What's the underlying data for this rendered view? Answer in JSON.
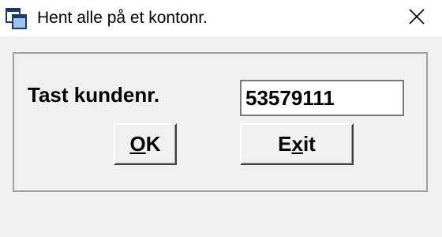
{
  "window": {
    "title": "Hent alle på et kontonr.",
    "icon": "app-window-icon",
    "close_icon": "close-icon"
  },
  "form": {
    "prompt_label": "Tast kundenr.",
    "customer_number_value": "53579111",
    "ok_button": {
      "accel": "O",
      "rest": "K"
    },
    "exit_button": {
      "pre": "E",
      "accel": "x",
      "rest": "it"
    }
  }
}
